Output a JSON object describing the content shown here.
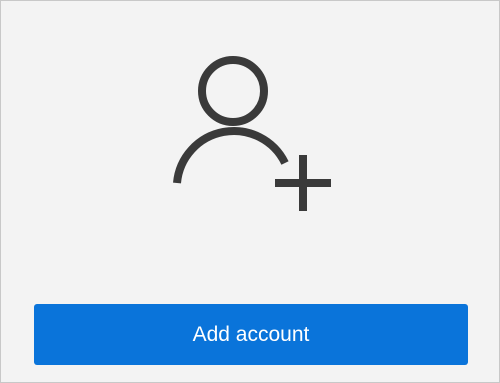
{
  "screen": {
    "icon": "add-user-icon",
    "accent_color": "#0a74da",
    "icon_color": "#3a3a3a",
    "background_color": "#f3f3f3"
  },
  "actions": {
    "add_account_label": "Add account"
  }
}
